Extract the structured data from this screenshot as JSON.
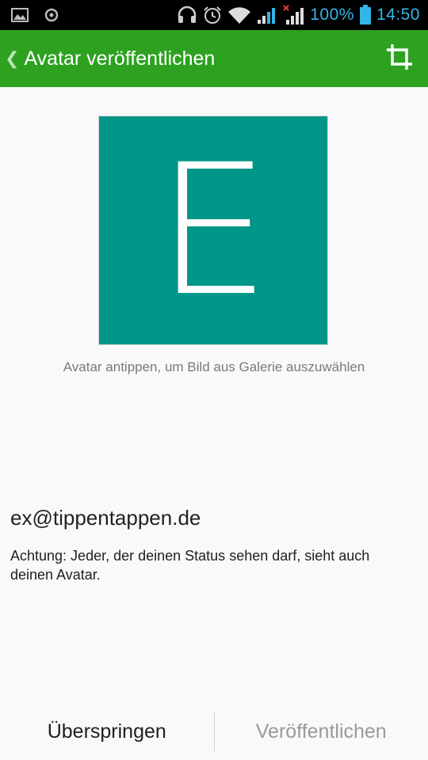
{
  "status_bar": {
    "icons_left": [
      "image-icon",
      "record-icon"
    ],
    "icons_right": [
      "headset-icon",
      "alarm-icon",
      "wifi-icon",
      "signal-icon",
      "signal-no-service-icon",
      "battery-icon"
    ],
    "battery_percent": "100%",
    "time": "14:50",
    "accent_color": "#33b5e5"
  },
  "app_bar": {
    "title": "Avatar veröffentlichen",
    "back_icon": "chevron-left-icon",
    "action_icon": "crop-icon",
    "color": "#2ea121"
  },
  "avatar": {
    "letter": "E",
    "background_color": "#009688"
  },
  "hint": "Avatar antippen, um Bild aus Galerie auszuwählen",
  "account": {
    "email": "ex@tippentappen.de",
    "warning": "Achtung: Jeder, der deinen Status sehen darf, sieht auch deinen Avatar."
  },
  "actions": {
    "skip_label": "Überspringen",
    "publish_label": "Veröffentlichen"
  }
}
